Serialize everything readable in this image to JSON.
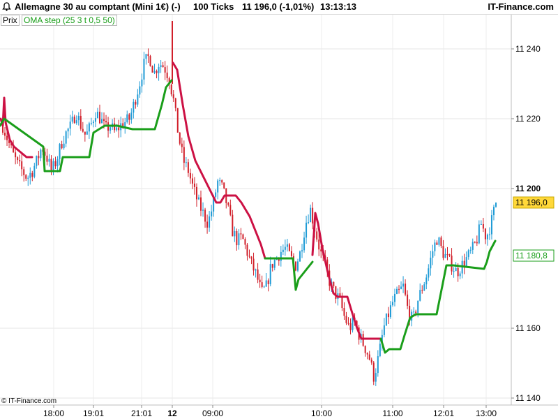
{
  "header": {
    "instrument": "Allemagne 30 au comptant (Mini 1€) (-)",
    "ticks": "100 Ticks",
    "last": "11 196,0 (-1,01%)",
    "time": "13:13:13",
    "brand": "IT-Finance.com"
  },
  "legend": {
    "price": "Prix",
    "indicator": "OMA step (25 3 t 0,5 50)"
  },
  "footer": {
    "copyright": "© IT-Finance.com"
  },
  "colors": {
    "up": "#1f9bd6",
    "down": "#d11f2a",
    "oma_high": "#cc1144",
    "oma_low": "#1a9e1a"
  },
  "chart_data": {
    "type": "line",
    "y_ticks": [
      "11 240",
      "11 220",
      "11 200",
      "11 160",
      "11 140"
    ],
    "ylim": [
      11138,
      11250
    ],
    "x_ticks": [
      "18:00",
      "19:01",
      "21:01",
      "12",
      "09:00",
      "10:00",
      "11:00",
      "12:01",
      "13:00"
    ],
    "price_label": "11 196,0",
    "oma_label": "11 180,8",
    "price_value": 11196.0,
    "oma_value": 11180.8,
    "price_path": [
      11218,
      11214,
      11210,
      11207,
      11205,
      11203,
      11205,
      11208,
      11212,
      11209,
      11205,
      11208,
      11213,
      11216,
      11218,
      11222,
      11218,
      11215,
      11218,
      11222,
      11220,
      11217,
      11218,
      11216,
      11218,
      11219,
      11220,
      11225,
      11230,
      11236,
      11238,
      11233,
      11236,
      11235,
      11232,
      11225,
      11215,
      11208,
      11205,
      11200,
      11196,
      11193,
      11190,
      11195,
      11202,
      11200,
      11195,
      11188,
      11185,
      11186,
      11182,
      11178,
      11175,
      11170,
      11172,
      11178,
      11180,
      11182,
      11183,
      11180,
      11178,
      11182,
      11190,
      11194,
      11188,
      11182,
      11178,
      11173,
      11170,
      11168,
      11163,
      11160,
      11162,
      11158,
      11155,
      11152,
      11146,
      11152,
      11160,
      11164,
      11168,
      11170,
      11172,
      11165,
      11162,
      11168,
      11172,
      11176,
      11182,
      11186,
      11182,
      11180,
      11178,
      11176,
      11178,
      11180,
      11182,
      11185,
      11190,
      11186,
      11190,
      11196
    ],
    "oma_upper": [
      {
        "x": 1,
        "y": 11220
      },
      {
        "x": 4,
        "y": 11218
      },
      {
        "x": 6,
        "y": 11226
      },
      {
        "x": 8,
        "y": 11219
      },
      {
        "x": 14,
        "y": 11214
      },
      {
        "x": 20,
        "y": 11212
      },
      {
        "x": 26,
        "y": 11211
      },
      {
        "x": 32,
        "y": 11210
      },
      {
        "x": 38,
        "y": 11209
      },
      {
        "x": 46,
        "y": 11209
      },
      {
        "x": 248,
        "y": 11236
      },
      {
        "x": 254,
        "y": 11234
      },
      {
        "x": 262,
        "y": 11224
      },
      {
        "x": 270,
        "y": 11215
      },
      {
        "x": 280,
        "y": 11208
      },
      {
        "x": 290,
        "y": 11204
      },
      {
        "x": 300,
        "y": 11200
      },
      {
        "x": 310,
        "y": 11196
      },
      {
        "x": 316,
        "y": 11196
      },
      {
        "x": 322,
        "y": 11198
      },
      {
        "x": 338,
        "y": 11198
      },
      {
        "x": 346,
        "y": 11196
      },
      {
        "x": 352,
        "y": 11194
      },
      {
        "x": 358,
        "y": 11192
      },
      {
        "x": 366,
        "y": 11188
      },
      {
        "x": 374,
        "y": 11184
      },
      {
        "x": 380,
        "y": 11180
      },
      {
        "x": 448,
        "y": 11181
      },
      {
        "x": 452,
        "y": 11193
      },
      {
        "x": 456,
        "y": 11190
      },
      {
        "x": 462,
        "y": 11183
      },
      {
        "x": 470,
        "y": 11176
      },
      {
        "x": 478,
        "y": 11170
      },
      {
        "x": 484,
        "y": 11169
      },
      {
        "x": 498,
        "y": 11169
      },
      {
        "x": 504,
        "y": 11165
      },
      {
        "x": 512,
        "y": 11160
      },
      {
        "x": 518,
        "y": 11157
      },
      {
        "x": 530,
        "y": 11157
      },
      {
        "x": 546,
        "y": 11157
      }
    ],
    "oma_lower": [
      {
        "x": 0,
        "y": 11218
      },
      {
        "x": 6,
        "y": 11220
      },
      {
        "x": 62,
        "y": 11212
      },
      {
        "x": 64,
        "y": 11205
      },
      {
        "x": 86,
        "y": 11205
      },
      {
        "x": 90,
        "y": 11209
      },
      {
        "x": 104,
        "y": 11209
      },
      {
        "x": 128,
        "y": 11209
      },
      {
        "x": 134,
        "y": 11216
      },
      {
        "x": 150,
        "y": 11218
      },
      {
        "x": 168,
        "y": 11218
      },
      {
        "x": 190,
        "y": 11217
      },
      {
        "x": 222,
        "y": 11217
      },
      {
        "x": 232,
        "y": 11224
      },
      {
        "x": 238,
        "y": 11229
      },
      {
        "x": 246,
        "y": 11231
      },
      {
        "x": 380,
        "y": 11180
      },
      {
        "x": 420,
        "y": 11180
      },
      {
        "x": 424,
        "y": 11171
      },
      {
        "x": 428,
        "y": 11174
      },
      {
        "x": 436,
        "y": 11176
      },
      {
        "x": 444,
        "y": 11178
      },
      {
        "x": 448,
        "y": 11179
      },
      {
        "x": 546,
        "y": 11157
      },
      {
        "x": 552,
        "y": 11153
      },
      {
        "x": 558,
        "y": 11154
      },
      {
        "x": 574,
        "y": 11154
      },
      {
        "x": 580,
        "y": 11158
      },
      {
        "x": 588,
        "y": 11163
      },
      {
        "x": 596,
        "y": 11164
      },
      {
        "x": 626,
        "y": 11164
      },
      {
        "x": 632,
        "y": 11170
      },
      {
        "x": 640,
        "y": 11178
      },
      {
        "x": 650,
        "y": 11178
      },
      {
        "x": 694,
        "y": 11177
      },
      {
        "x": 698,
        "y": 11179
      },
      {
        "x": 702,
        "y": 11182
      },
      {
        "x": 710,
        "y": 11185
      }
    ]
  }
}
